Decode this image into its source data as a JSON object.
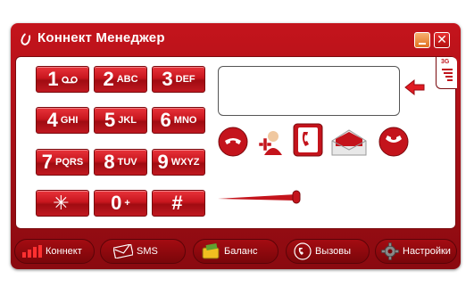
{
  "window": {
    "title": "Коннект Менеджер"
  },
  "keypad": [
    {
      "digit": "1",
      "letters": "",
      "voicemail": true
    },
    {
      "digit": "2",
      "letters": "ABC"
    },
    {
      "digit": "3",
      "letters": "DEF"
    },
    {
      "digit": "4",
      "letters": "GHI"
    },
    {
      "digit": "5",
      "letters": "JKL"
    },
    {
      "digit": "6",
      "letters": "MNO"
    },
    {
      "digit": "7",
      "letters": "PQRS"
    },
    {
      "digit": "8",
      "letters": "TUV"
    },
    {
      "digit": "9",
      "letters": "WXYZ"
    },
    {
      "digit": "✳",
      "letters": ""
    },
    {
      "digit": "0",
      "letters": "+"
    },
    {
      "digit": "#",
      "letters": ""
    }
  ],
  "display": {
    "number": ""
  },
  "signal": {
    "network": "3G"
  },
  "actions": [
    {
      "name": "call-icon"
    },
    {
      "name": "add-contact-icon"
    },
    {
      "name": "phonebook-icon"
    },
    {
      "name": "messages-icon"
    },
    {
      "name": "hangup-icon"
    }
  ],
  "tabs": [
    {
      "label": "Коннект",
      "icon": "signal-bars-icon"
    },
    {
      "label": "SMS",
      "icon": "envelope-icon"
    },
    {
      "label": "Баланс",
      "icon": "wallet-icon"
    },
    {
      "label": "Вызовы",
      "icon": "phone-icon"
    },
    {
      "label": "Настройки",
      "icon": "gear-icon"
    }
  ],
  "colors": {
    "brand": "#c4141c",
    "dark": "#7a0a0e"
  }
}
